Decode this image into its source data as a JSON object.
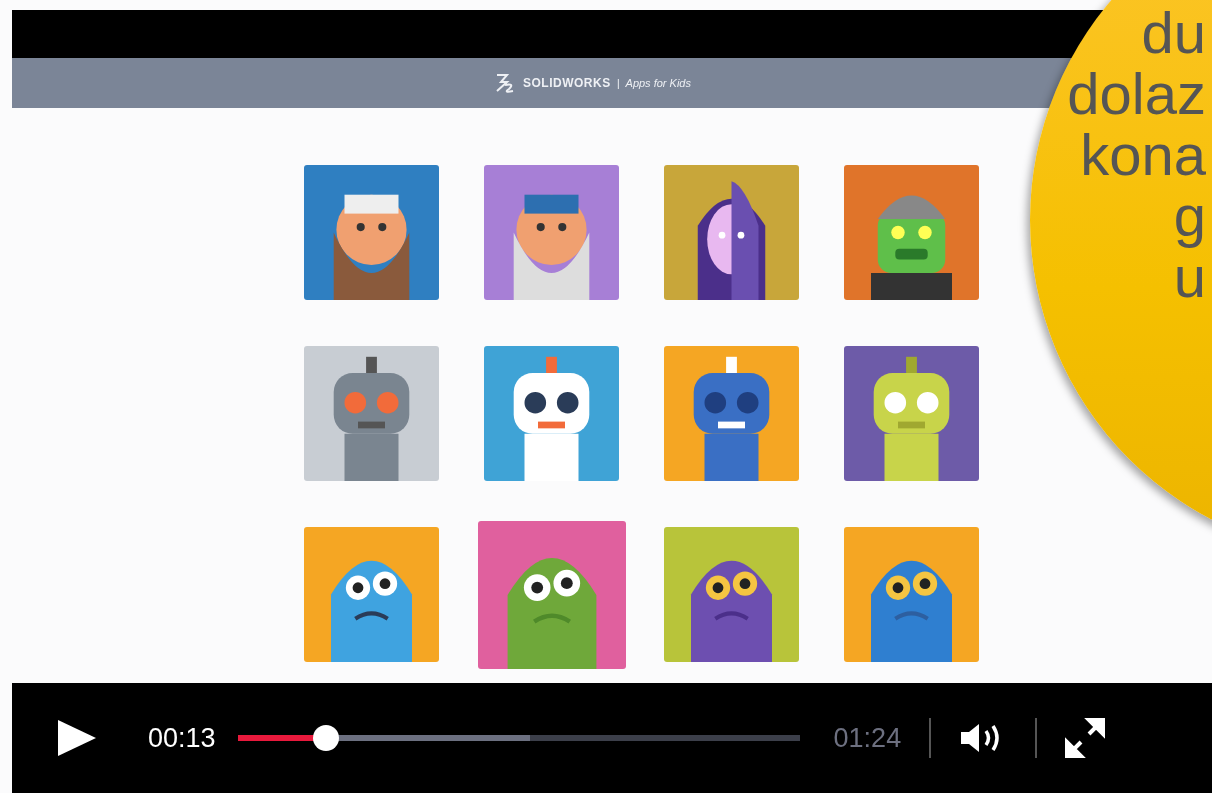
{
  "header": {
    "brand": "SOLIDWORKS",
    "separator": "|",
    "tagline": "Apps for Kids"
  },
  "avatars": [
    {
      "kind": "bearded",
      "color": "#2f7fc1"
    },
    {
      "kind": "bearded",
      "color": "#a77fd6"
    },
    {
      "kind": "face",
      "color": "#c8a63a"
    },
    {
      "kind": "helmet",
      "color": "#e0742a"
    },
    {
      "kind": "robot",
      "color": "#c8cdd3"
    },
    {
      "kind": "robot",
      "color": "#3fa3d6"
    },
    {
      "kind": "robot",
      "color": "#f5a623"
    },
    {
      "kind": "robot",
      "color": "#6d5ba8"
    },
    {
      "kind": "monster",
      "color": "#f5a623"
    },
    {
      "kind": "monster",
      "color": "#e0609e"
    },
    {
      "kind": "monster",
      "color": "#b8c43a"
    },
    {
      "kind": "monster",
      "color": "#f5a623"
    }
  ],
  "player": {
    "current_time": "00:13",
    "duration": "01:24",
    "progress": {
      "level": 0.157
    },
    "buffered": {
      "level": 0.52
    }
  },
  "callout": {
    "lines": [
      "du",
      "dolaz",
      "kona",
      "g",
      "u"
    ]
  }
}
